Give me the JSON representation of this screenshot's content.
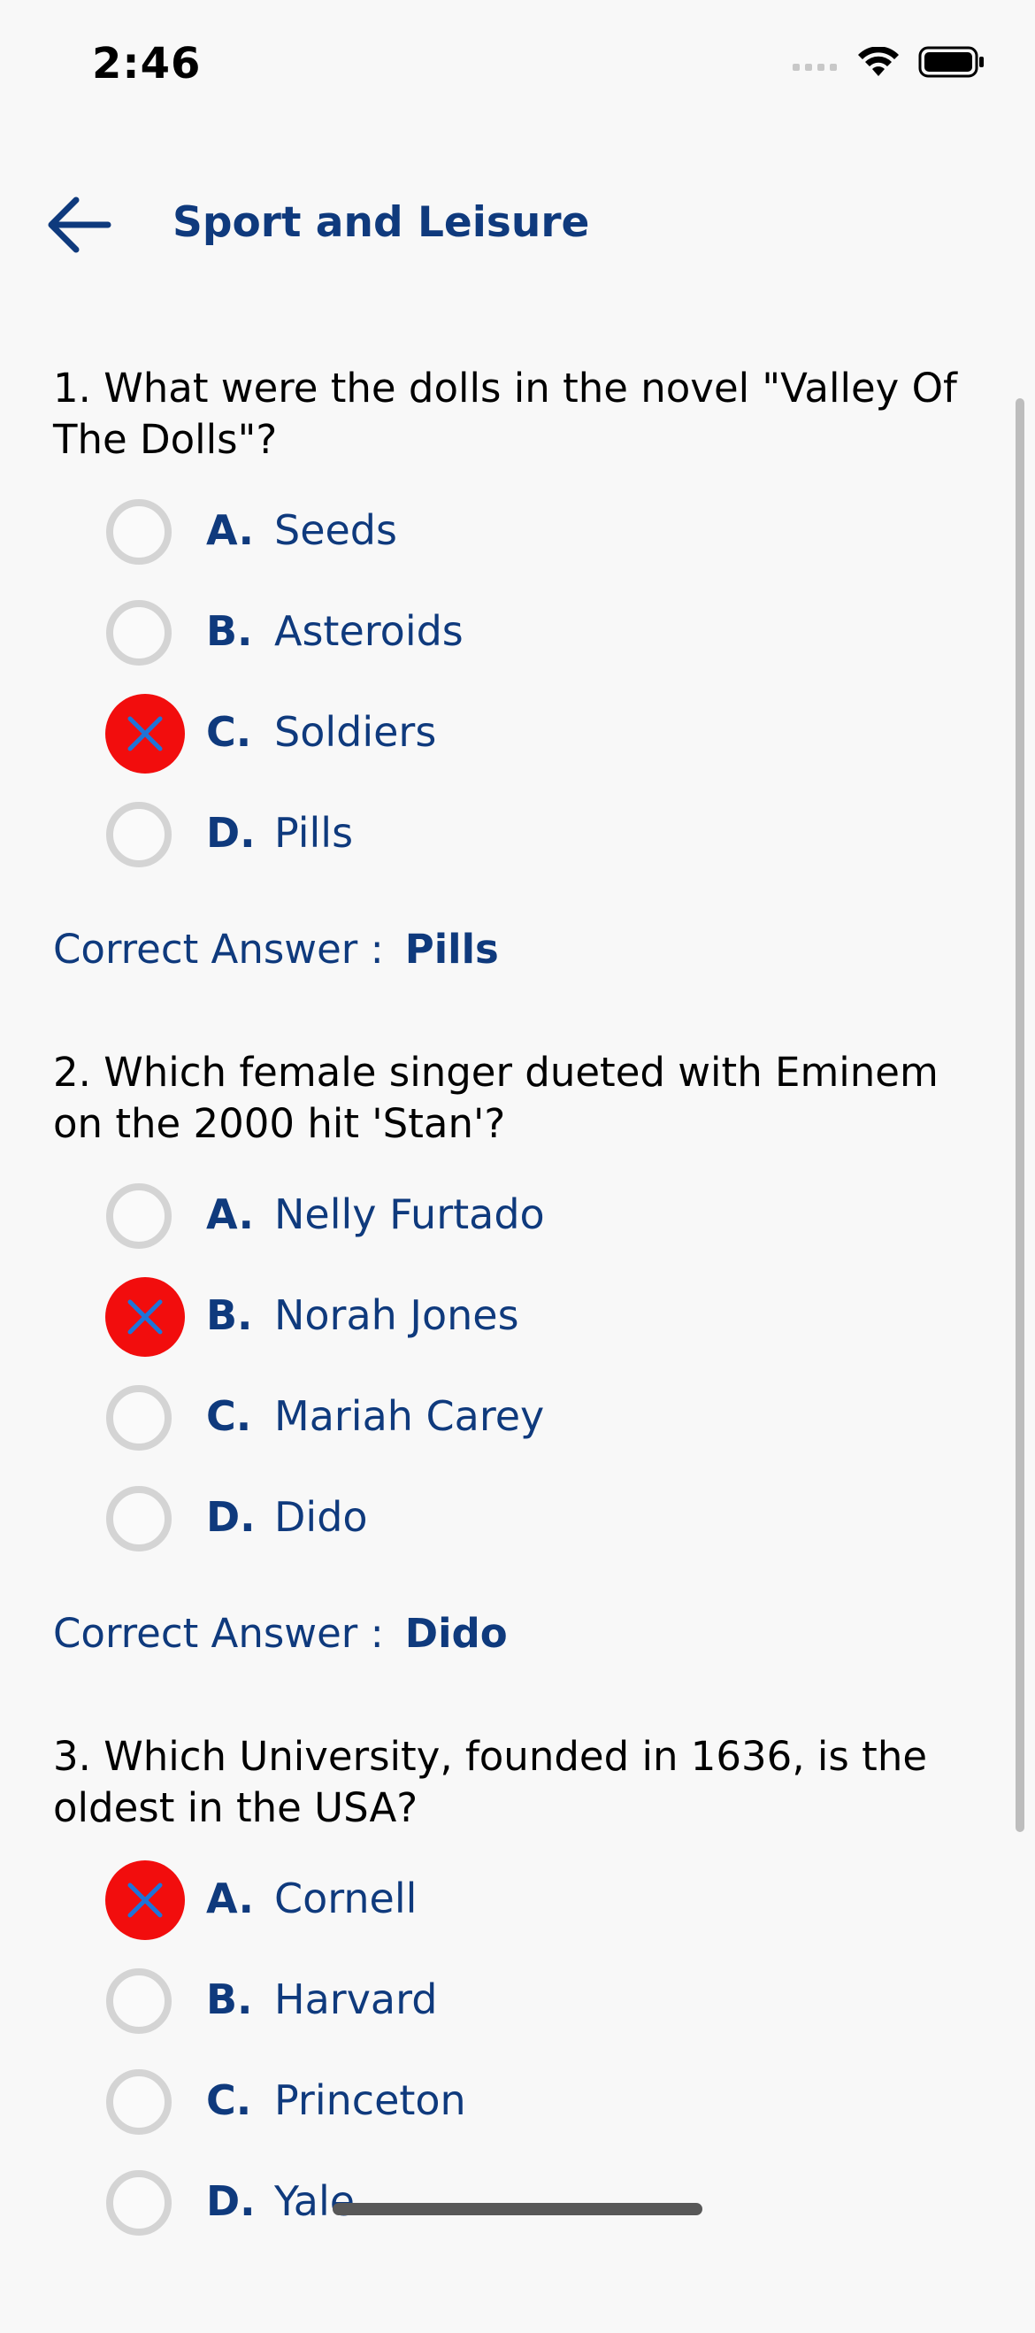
{
  "status_bar": {
    "time": "2:46"
  },
  "header": {
    "title": "Sport and Leisure",
    "back_icon": "arrow-left-icon"
  },
  "colors": {
    "primary": "#0f3a7d",
    "wrong_selected": "#f20d0d",
    "cross_mark": "#1e74d8",
    "radio_border": "#d4d4d4",
    "background": "#f8f8f8"
  },
  "questions": [
    {
      "text": "1. What were the dolls in the novel \"Valley Of The Dolls\"?",
      "options": [
        {
          "letter": "A.",
          "text": "Seeds",
          "state": "unselected"
        },
        {
          "letter": "B.",
          "text": "Asteroids",
          "state": "unselected"
        },
        {
          "letter": "C.",
          "text": "Soldiers",
          "state": "selected-wrong"
        },
        {
          "letter": "D.",
          "text": "Pills",
          "state": "unselected"
        }
      ],
      "correct_label": "Correct Answer :",
      "correct_answer": "Pills"
    },
    {
      "text": "2. Which female singer dueted with Eminem on the 2000 hit 'Stan'?",
      "options": [
        {
          "letter": "A.",
          "text": "Nelly Furtado",
          "state": "unselected"
        },
        {
          "letter": "B.",
          "text": "Norah Jones",
          "state": "selected-wrong"
        },
        {
          "letter": "C.",
          "text": "Mariah Carey",
          "state": "unselected"
        },
        {
          "letter": "D.",
          "text": "Dido",
          "state": "unselected"
        }
      ],
      "correct_label": "Correct Answer :",
      "correct_answer": "Dido"
    },
    {
      "text": "3. Which University, founded in 1636, is the oldest in the USA?",
      "options": [
        {
          "letter": "A.",
          "text": "Cornell",
          "state": "selected-wrong"
        },
        {
          "letter": "B.",
          "text": "Harvard",
          "state": "unselected"
        },
        {
          "letter": "C.",
          "text": "Princeton",
          "state": "unselected"
        },
        {
          "letter": "D.",
          "text": "Yale",
          "state": "unselected"
        }
      ]
    }
  ]
}
